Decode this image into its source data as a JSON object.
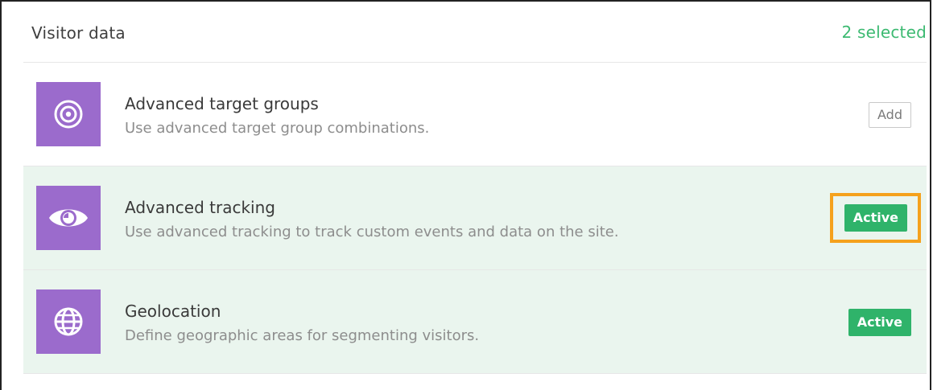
{
  "section": {
    "title": "Visitor data",
    "selected_count": "2 selected"
  },
  "items": [
    {
      "title": "Advanced target groups",
      "description": "Use advanced target group combinations.",
      "icon": "target-icon",
      "status": "Add",
      "active": false
    },
    {
      "title": "Advanced tracking",
      "description": "Use advanced tracking to track custom events and data on the site.",
      "icon": "eye-icon",
      "status": "Active",
      "active": true
    },
    {
      "title": "Geolocation",
      "description": "Define geographic areas for segmenting visitors.",
      "icon": "globe-icon",
      "status": "Active",
      "active": true
    }
  ],
  "colors": {
    "icon_bg": "#9b6bcc",
    "active_green": "#2fb36a",
    "selected_text": "#3dba72",
    "active_row_bg": "#eaf5ee",
    "highlight": "#f5a11c"
  }
}
